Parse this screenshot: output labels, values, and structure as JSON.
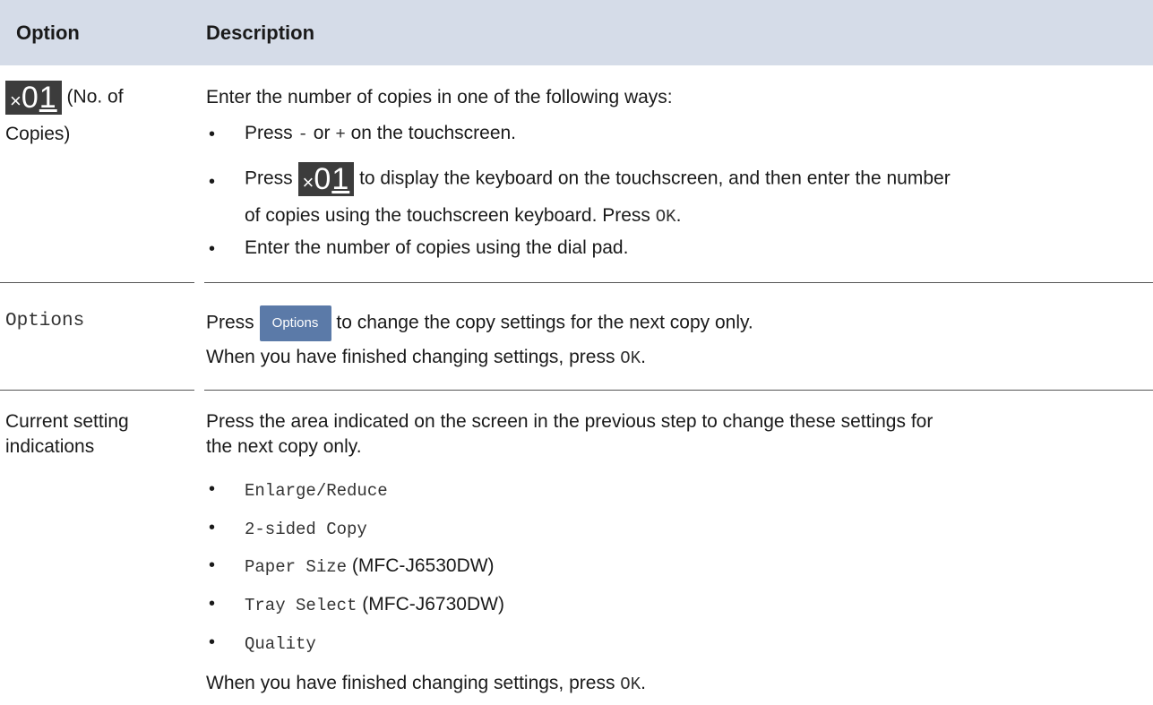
{
  "header": {
    "option": "Option",
    "description": "Description"
  },
  "row1": {
    "badge_x": "×",
    "badge_digits": "0",
    "badge_last": "1",
    "option_suffix_1": "(No. of",
    "option_suffix_2": "Copies)",
    "intro": "Enter the number of copies in one of the following ways:",
    "b1_pre": "Press",
    "b1_minus": "-",
    "b1_or": "or",
    "b1_plus": "+",
    "b1_post": "on the touchscreen.",
    "b2_pre": "Press",
    "b2_post": "to display the keyboard on the touchscreen, and then enter the number",
    "b2_line2": "of copies using the touchscreen keyboard. Press",
    "b2_ok": "OK",
    "b2_end": ".",
    "b3": "Enter the number of copies using the dial pad."
  },
  "row2": {
    "option": "Options",
    "p1_pre": "Press",
    "button_label": "Options",
    "p1_post": "to change the copy settings for the next copy only.",
    "p2": "When you have finished changing settings, press",
    "p2_ok": "OK",
    "p2_end": "."
  },
  "row3": {
    "option_1": "Current setting",
    "option_2": "indications",
    "intro_1": "Press the area indicated on the screen in the previous step to change these settings for",
    "intro_2": "the next copy only.",
    "items": [
      {
        "mono": "Enlarge/Reduce",
        "note": ""
      },
      {
        "mono": "2-sided Copy",
        "note": ""
      },
      {
        "mono": "Paper Size",
        "note": "(MFC-J6530DW)"
      },
      {
        "mono": "Tray Select",
        "note": "(MFC-J6730DW)"
      },
      {
        "mono": "Quality",
        "note": ""
      }
    ],
    "closing": "When you have finished changing settings, press",
    "closing_ok": "OK",
    "closing_end": "."
  },
  "bullet": "•"
}
